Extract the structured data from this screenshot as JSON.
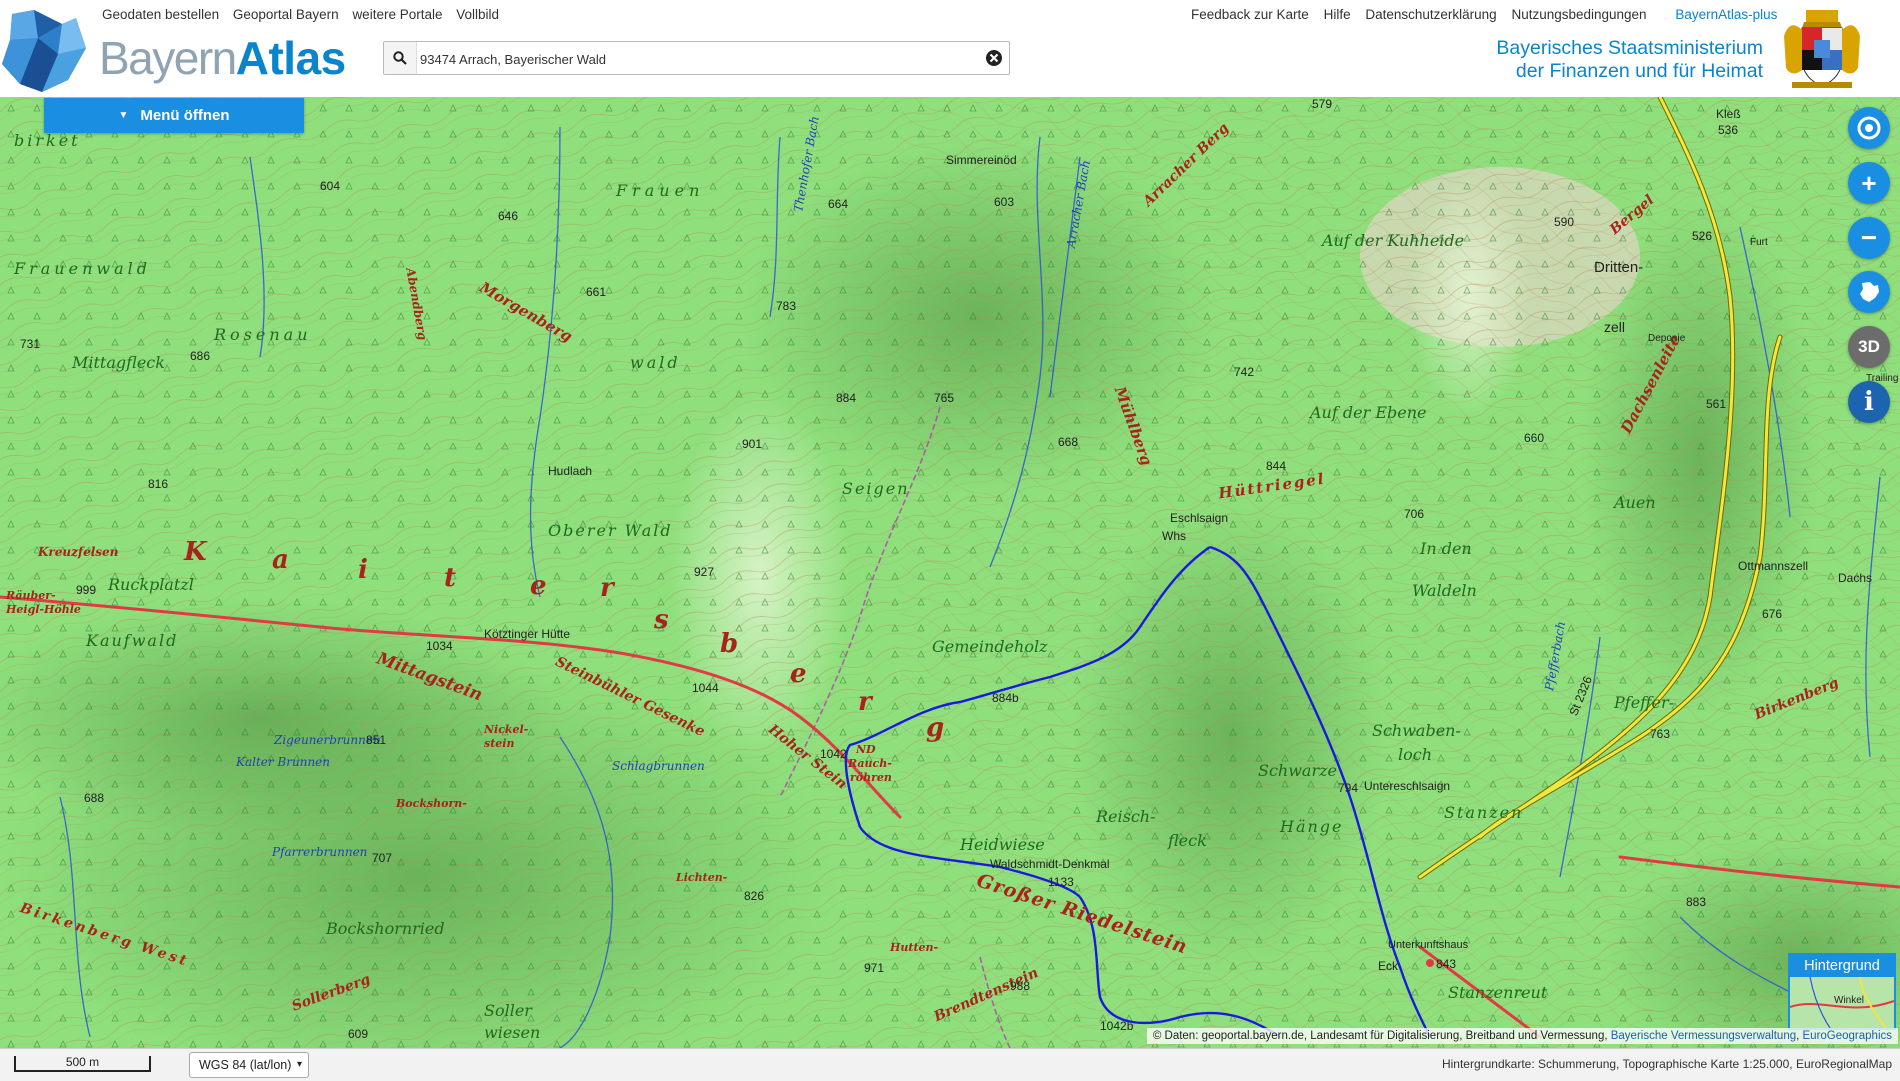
{
  "header": {
    "brand_part1": "Bayern",
    "brand_part2": "Atlas",
    "nav_left": [
      "Geodaten bestellen",
      "Geoportal Bayern",
      "weitere Portale",
      "Vollbild"
    ],
    "nav_right": [
      "Feedback zur Karte",
      "Hilfe",
      "Datenschutzerklärung",
      "Nutzungsbedingungen"
    ],
    "nav_plus": "BayernAtlas-plus",
    "search_value": "93474 Arrach, Bayerischer Wald",
    "ministry_line1": "Bayerisches Staatsministerium",
    "ministry_line2": "der Finanzen und für Heimat"
  },
  "menu": {
    "label": "Menü öffnen"
  },
  "controls": {
    "locate": "locate-icon",
    "zoom_in": "+",
    "zoom_out": "−",
    "bavaria": "bavaria-icon",
    "three_d": "3D",
    "info": "i"
  },
  "background_switcher": {
    "label": "Hintergrund",
    "thumb_label": "Winkel"
  },
  "attribution": {
    "prefix": "© Daten: geoportal.bayern.de, Landesamt für Digitalisierung, Breitband und Vermessung, ",
    "link1": "Bayerische Vermessungsverwaltung",
    "sep": ", ",
    "link2": "EuroGeographics"
  },
  "footer": {
    "scale": "500 m",
    "crs": "WGS 84 (lat/lon)",
    "basemap": "Hintergrundkarte: Schummerung, Topographische Karte 1:25.000, EuroRegionalMap"
  },
  "colors": {
    "accent": "#1a8ee0",
    "map_green": "#8fe07d",
    "route_blue": "#1a1adf",
    "road_red": "#e0303a",
    "road_yellow": "#f0e030"
  },
  "map_labels": {
    "kaitersberg": [
      "K",
      "a",
      "i",
      "t",
      "e",
      "r",
      "s",
      "b",
      "e",
      "r",
      "g"
    ],
    "places": [
      "Simmereinöd",
      "Frauen",
      "Frauenwald",
      "Rosenau",
      "Mittagfleck",
      "Morgenberg",
      "Abendberg",
      "Hudlach",
      "Oberer Wald",
      "Seigen",
      "wald",
      "Mühlberg",
      "Hüttriegel",
      "Eschlsaign",
      "Whs",
      "Auf der Kuhheide",
      "Auf der Ebene",
      "In den",
      "Waldeln",
      "Dritten-",
      "zell",
      "Bergel",
      "Dachsenleite",
      "Deponie",
      "Auen",
      "Ottmannszell",
      "Dachs",
      "Gemeindeholz",
      "Ruckplatzl",
      "Kreuzfelsen",
      "Räuber-",
      "Heigl-Höhle",
      "Kötztinger Hütte",
      "Kaufwald",
      "Mittagstein",
      "Steinbühler Gesenke",
      "Hoher Stein",
      "Rauch-",
      "röhren",
      "ND",
      "Schlagbrunnen",
      "Zigeunerbrunnen",
      "Kalter Brunnen",
      "Nickel-",
      "stein",
      "Bockshorn-",
      "Pfarrerbrunnen",
      "Heidwiese",
      "Waldschmidt-Denkmal",
      "Großer Riedelstein",
      "Reisch-",
      "fleck",
      "Schwarze",
      "Hänge",
      "Untereschlsaign",
      "Schwaben-",
      "loch",
      "Stanzen",
      "Pfeffer-",
      "Birkenberg",
      "Unterkunftshaus",
      "Eck",
      "Stanzenreut",
      "Lichten-",
      "Hutten-",
      "Brendtenstein",
      "Bockshornried",
      "Sollerberg",
      "Soller",
      "wiesen",
      "Kleß",
      "Furt",
      "Pfefferbach",
      "Arracher Bach",
      "Thenhofer Bach",
      "Arracher Berg",
      "St 2326",
      "Birkenberg West",
      "birket",
      "Trailing"
    ],
    "heights": [
      "604",
      "646",
      "664",
      "603",
      "579",
      "661",
      "783",
      "731",
      "686",
      "884",
      "765",
      "668",
      "742",
      "844",
      "590",
      "526",
      "536",
      "561",
      "660",
      "706",
      "816",
      "999",
      "1034",
      "927",
      "901",
      "1044",
      "851",
      "884b",
      "1042",
      "794",
      "676",
      "763",
      "688",
      "707",
      "826",
      "1133",
      "971",
      "988",
      "609",
      "843",
      "883",
      "1042b"
    ]
  }
}
